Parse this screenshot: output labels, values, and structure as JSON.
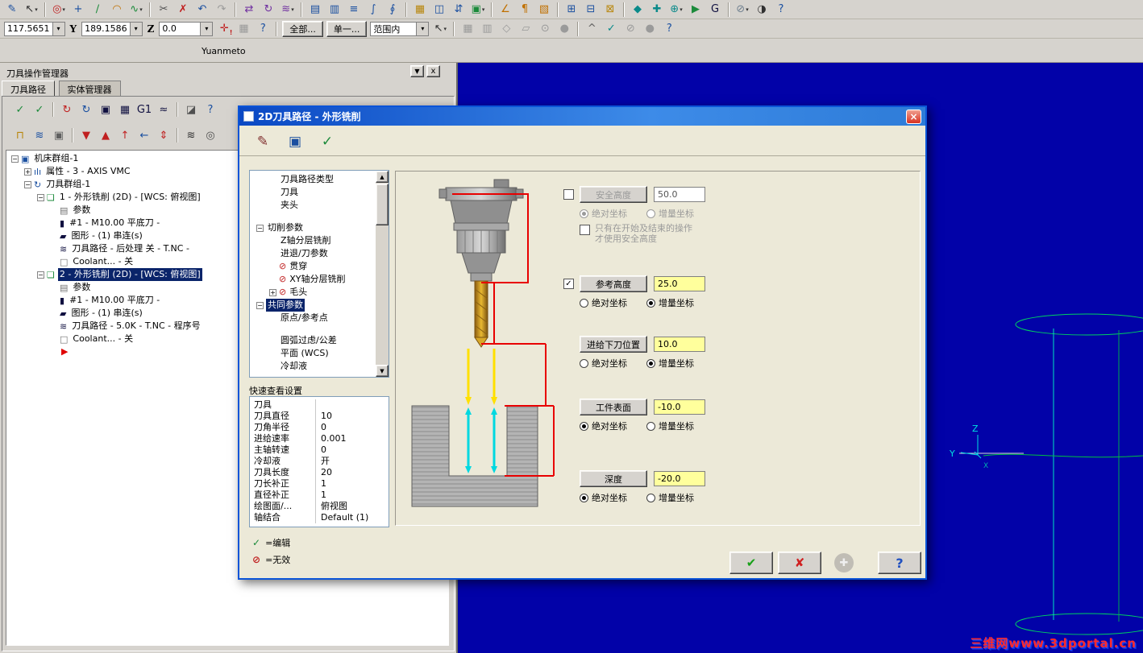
{
  "app": {
    "label": "Yuanmeto"
  },
  "colors": {
    "selection_blue": "#0a246a",
    "value_yellow": "#ffff9c",
    "viewport_blue": "#0202a8",
    "level_line_red": "#e80000",
    "rapid_arrow_yellow": "#ffe000",
    "feed_arrow_cyan": "#00d8e0",
    "ok_green": "#18a018",
    "cancel_red": "#d02020"
  },
  "toolbar_main": {
    "icons": [
      {
        "n": "sketch-icon",
        "g": "✎",
        "c": "#1a4fa0"
      },
      {
        "n": "cursor-select-icon",
        "g": "↖",
        "c": "#303030",
        "dd": true
      },
      {
        "sep": true
      },
      {
        "n": "analyze-icon",
        "g": "◎",
        "c": "#c02020",
        "dd": true
      },
      {
        "n": "point-icon",
        "g": "+",
        "c": "#1a4fa0"
      },
      {
        "n": "line-icon",
        "g": "∕",
        "c": "#1b8a3a"
      },
      {
        "n": "arc-icon",
        "g": "◠",
        "c": "#c07000"
      },
      {
        "n": "spline-icon",
        "g": "∿",
        "c": "#1b8a3a",
        "dd": true
      },
      {
        "sep": true
      },
      {
        "n": "trim-icon",
        "g": "✂",
        "c": "#505050"
      },
      {
        "n": "delete-icon",
        "g": "✗",
        "c": "#c02020"
      },
      {
        "n": "undo-icon",
        "g": "↶",
        "c": "#1a4fa0"
      },
      {
        "n": "redo-icon",
        "g": "↷",
        "c": "#9a9a9a"
      },
      {
        "sep": true
      },
      {
        "n": "xform-mirror-icon",
        "g": "⇄",
        "c": "#7030a0"
      },
      {
        "n": "xform-rotate-icon",
        "g": "↻",
        "c": "#7030a0"
      },
      {
        "n": "xform-offset-icon",
        "g": "≋",
        "c": "#7030a0",
        "dd": true
      },
      {
        "sep": true
      },
      {
        "n": "levels-icon",
        "g": "▤",
        "c": "#1a4fa0"
      },
      {
        "n": "attributes-icon",
        "g": "▥",
        "c": "#1a4fa0"
      },
      {
        "n": "groups-icon",
        "g": "≡",
        "c": "#1a4fa0"
      },
      {
        "n": "mask-icon",
        "g": "∫",
        "c": "#1a4fa0"
      },
      {
        "n": "blank-icon",
        "g": "∮",
        "c": "#1a4fa0"
      },
      {
        "sep": true
      },
      {
        "n": "grid-icon",
        "g": "▦",
        "c": "#b8860b"
      },
      {
        "n": "viewsheet-icon",
        "g": "◫",
        "c": "#1a4fa0"
      },
      {
        "n": "combine-views-icon",
        "g": "⇵",
        "c": "#1a4fa0"
      },
      {
        "n": "shade-icon",
        "g": "▣",
        "c": "#1b8a3a",
        "dd": true
      },
      {
        "sep": true
      },
      {
        "n": "dimension-icon",
        "g": "∠",
        "c": "#c07000"
      },
      {
        "n": "note-icon",
        "g": "¶",
        "c": "#c07000"
      },
      {
        "n": "hatch-icon",
        "g": "▧",
        "c": "#c07000"
      },
      {
        "sep": true
      },
      {
        "n": "machine-def-icon",
        "g": "⊞",
        "c": "#1a4fa0"
      },
      {
        "n": "control-def-icon",
        "g": "⊟",
        "c": "#1a4fa0"
      },
      {
        "n": "material-icon",
        "g": "⊠",
        "c": "#b8860b"
      },
      {
        "sep": true
      },
      {
        "n": "toolpath-contour-icon",
        "g": "◆",
        "c": "#0a8a8a"
      },
      {
        "n": "toolpath-drill-icon",
        "g": "✚",
        "c": "#0a8a8a"
      },
      {
        "n": "toolpath-pocket-icon",
        "g": "⊕",
        "c": "#0a8a8a",
        "dd": true
      },
      {
        "n": "verify-icon",
        "g": "▶",
        "c": "#1b8a3a"
      },
      {
        "n": "post-icon",
        "g": "G",
        "c": "#101040"
      },
      {
        "sep": true
      },
      {
        "n": "utilities-icon",
        "g": "⊘",
        "c": "#708090",
        "dd": true
      },
      {
        "n": "settings-icon",
        "g": "◑",
        "c": "#303030"
      },
      {
        "n": "help-icon",
        "g": "?",
        "c": "#1a4fa0"
      }
    ]
  },
  "toolbar_second": {
    "coord_x": "117.5651",
    "axis_y": "Y",
    "coord_y": "189.1586",
    "axis_z": "Z",
    "coord_z": "0.0",
    "btn_all": "全部...",
    "btn_single": "单一...",
    "combo_range": "范围内",
    "icons_mid": [
      {
        "n": "autocursor-icon",
        "g": "✛",
        "c": "#c02020",
        "badge": "!"
      },
      {
        "n": "fastpoint-icon",
        "g": "▦",
        "c": "#a0a0a0",
        "disabled": true
      },
      {
        "n": "cursor-help-icon",
        "g": "?",
        "c": "#1a4fa0"
      },
      {
        "sep": true
      }
    ],
    "icons_right": [
      {
        "n": "selection-pointer-icon",
        "g": "↖",
        "c": "#303030",
        "dd": true
      },
      {
        "sep": true
      },
      {
        "n": "select-window-icon",
        "g": "▦",
        "c": "#9a9a9a",
        "disabled": true
      },
      {
        "n": "select-group-icon",
        "g": "▥",
        "c": "#9a9a9a",
        "disabled": true
      },
      {
        "n": "select-polygon-icon",
        "g": "◇",
        "c": "#9a9a9a",
        "disabled": true
      },
      {
        "n": "select-vector-icon",
        "g": "▱",
        "c": "#9a9a9a",
        "disabled": true
      },
      {
        "n": "select-area-icon",
        "g": "⊙",
        "c": "#9a9a9a",
        "disabled": true
      },
      {
        "n": "select-solid-icon",
        "g": "●",
        "c": "#9a9a9a",
        "disabled": true
      },
      {
        "sep": true
      },
      {
        "n": "select-last-icon",
        "g": "^",
        "c": "#606060"
      },
      {
        "n": "validate-selection-icon",
        "g": "✓",
        "c": "#0a8a8a"
      },
      {
        "n": "select-invert-icon",
        "g": "⊘",
        "c": "#9a9a9a",
        "disabled": true
      },
      {
        "n": "select-mask-icon",
        "g": "●",
        "c": "#9a9a9a",
        "disabled": true
      },
      {
        "n": "quick-help-icon",
        "g": "?",
        "c": "#1a4fa0"
      }
    ]
  },
  "manager": {
    "title": "刀具操作管理器",
    "tabs": [
      "刀具路径",
      "实体管理器"
    ],
    "toolbar1": [
      {
        "n": "select-all-operations-icon",
        "g": "✓",
        "c": "#1b8a3a"
      },
      {
        "n": "select-dirty-operations-icon",
        "g": "✓",
        "c": "#1b8a3a"
      },
      {
        "sep": true
      },
      {
        "n": "regen-selected-icon",
        "g": "↻",
        "c": "#c02020"
      },
      {
        "n": "regen-all-icon",
        "g": "↻",
        "c": "#1a4fa0"
      },
      {
        "n": "backplot-icon",
        "g": "▣",
        "c": "#101040"
      },
      {
        "n": "verify-operations-icon",
        "g": "▦",
        "c": "#101040"
      },
      {
        "n": "post-g1-icon",
        "g": "G1",
        "c": "#101040"
      },
      {
        "n": "highfeed-icon",
        "g": "≈",
        "c": "#101040"
      },
      {
        "sep": true
      },
      {
        "n": "delete-operations-icon",
        "g": "◪",
        "c": "#505050"
      },
      {
        "n": "operations-help-icon",
        "g": "?",
        "c": "#1a4fa0"
      }
    ],
    "toolbar2": [
      {
        "n": "lock-icon",
        "g": "⊓",
        "c": "#b8860b"
      },
      {
        "n": "toggle-toolpath-display-icon",
        "g": "≋",
        "c": "#1a4fa0"
      },
      {
        "n": "toggle-post-icon",
        "g": "▣",
        "c": "#606060"
      },
      {
        "sep": true
      },
      {
        "n": "move-insert-down-icon",
        "g": "▼",
        "c": "#c02020"
      },
      {
        "n": "move-insert-up-icon",
        "g": "▲",
        "c": "#c02020"
      },
      {
        "n": "move-insert-top-icon",
        "g": "↑",
        "c": "#c02020"
      },
      {
        "n": "scroll-insert-icon",
        "g": "←",
        "c": "#1a4fa0"
      },
      {
        "n": "insert-arrow-icon",
        "g": "⇕",
        "c": "#c02020"
      },
      {
        "sep": true
      },
      {
        "n": "display-only-selected-icon",
        "g": "≋",
        "c": "#303030"
      },
      {
        "n": "toolpath-options-icon",
        "g": "◎",
        "c": "#505050"
      }
    ],
    "tree": [
      {
        "t": "机床群组-1",
        "lv": 0,
        "exp": "minus",
        "icon": "machine-group-icon",
        "g": "▣",
        "c": "#1a4fa0"
      },
      {
        "t": "属性 - 3 - AXIS VMC",
        "lv": 1,
        "exp": "plus",
        "icon": "properties-icon",
        "g": "ılı",
        "c": "#1a4fa0"
      },
      {
        "t": "刀具群组-1",
        "lv": 1,
        "exp": "minus",
        "icon": "tool-group-icon",
        "g": "↻",
        "c": "#1a4fa0"
      },
      {
        "t": "1 - 外形铣削 (2D) - [WCS: 俯视图]",
        "lv": 2,
        "exp": "minus",
        "icon": "operation-folder-icon",
        "g": "❏",
        "c": "#1b8a3a"
      },
      {
        "t": "参数",
        "lv": 3,
        "icon": "parameters-icon",
        "g": "▤",
        "c": "#707070"
      },
      {
        "t": "#1 - M10.00 平底刀 -",
        "lv": 3,
        "icon": "tool-icon",
        "g": "▮",
        "c": "#101040"
      },
      {
        "t": "图形 - (1) 串连(s)",
        "lv": 3,
        "icon": "geometry-icon",
        "g": "▰",
        "c": "#101040"
      },
      {
        "t": "刀具路径 - 后处理 关 - T.NC -",
        "lv": 3,
        "icon": "toolpath-file-icon",
        "g": "≋",
        "c": "#101040"
      },
      {
        "t": "Coolant... - 关",
        "lv": 3,
        "icon": "coolant-icon",
        "g": "□",
        "c": "#707070"
      },
      {
        "t": "2 - 外形铣削 (2D) - [WCS: 俯视图]",
        "lv": 2,
        "exp": "minus",
        "sel": true,
        "icon": "operation-folder-icon",
        "g": "❏",
        "c": "#1b8a3a"
      },
      {
        "t": "参数",
        "lv": 3,
        "icon": "parameters-icon",
        "g": "▤",
        "c": "#707070"
      },
      {
        "t": "#1 - M10.00 平底刀 -",
        "lv": 3,
        "icon": "tool-icon",
        "g": "▮",
        "c": "#101040"
      },
      {
        "t": "图形 - (1) 串连(s)",
        "lv": 3,
        "icon": "geometry-icon",
        "g": "▰",
        "c": "#101040"
      },
      {
        "t": "刀具路径 - 5.0K - T.NC - 程序号",
        "lv": 3,
        "icon": "toolpath-file-icon",
        "g": "≋",
        "c": "#101040"
      },
      {
        "t": "Coolant... - 关",
        "lv": 3,
        "icon": "coolant-icon",
        "g": "□",
        "c": "#707070"
      },
      {
        "t": "",
        "lv": 3,
        "marker": true
      }
    ]
  },
  "dialog": {
    "title": "2D刀具路径 - 外形铣削",
    "close_glyph": "×",
    "toolbar_icons": [
      {
        "n": "tool-icon",
        "g": "✎",
        "c": "#803030"
      },
      {
        "n": "save-parameters-icon",
        "g": "▣",
        "c": "#1a4fa0"
      },
      {
        "n": "verify-parameters-icon",
        "g": "✓",
        "c": "#1b8a3a"
      }
    ],
    "tree_items": [
      {
        "t": "刀具路径类型",
        "lv": 1
      },
      {
        "t": "刀具",
        "lv": 1
      },
      {
        "t": "夹头",
        "lv": 1
      },
      {
        "t": "切削参数",
        "lv": 0,
        "exp": "minus",
        "gap": true
      },
      {
        "t": "Z轴分层铣削",
        "lv": 1
      },
      {
        "t": "进退/刀参数",
        "lv": 1
      },
      {
        "t": "贯穿",
        "lv": 1,
        "mark": "invalid"
      },
      {
        "t": "XY轴分层铣削",
        "lv": 1,
        "mark": "invalid"
      },
      {
        "t": "毛头",
        "lv": 1,
        "exp": "plus",
        "mark": "invalid"
      },
      {
        "t": "共同参数",
        "lv": 0,
        "exp": "minus",
        "sel": true
      },
      {
        "t": "原点/参考点",
        "lv": 1
      },
      {
        "t": "圆弧过虑/公差",
        "lv": 1,
        "gap": true
      },
      {
        "t": "平面 (WCS)",
        "lv": 1
      },
      {
        "t": "冷却液",
        "lv": 1
      }
    ],
    "quick_title": "快速查看设置",
    "quick_rows": [
      {
        "k": "刀具",
        "v": ""
      },
      {
        "k": "刀具直径",
        "v": "10"
      },
      {
        "k": "刀角半径",
        "v": "0"
      },
      {
        "k": "进给速率",
        "v": "0.001"
      },
      {
        "k": "主轴转速",
        "v": "0"
      },
      {
        "k": "冷却液",
        "v": "开"
      },
      {
        "k": "刀具长度",
        "v": "20"
      },
      {
        "k": "刀长补正",
        "v": "1"
      },
      {
        "k": "直径补正",
        "v": "1"
      },
      {
        "k": "绘图面/...",
        "v": "俯视图"
      },
      {
        "k": "轴结合",
        "v": "Default (1)"
      }
    ],
    "legend": [
      {
        "mark": "✓",
        "color": "#1b8a3a",
        "text": "=编辑"
      },
      {
        "mark": "⊘",
        "color": "#c02020",
        "text": "=无效"
      }
    ],
    "params": {
      "abs_label": "绝对坐标",
      "inc_label": "增量坐标",
      "rows": [
        {
          "key": "safety",
          "label": "安全高度",
          "value": "50.0",
          "checkbox": "unchecked",
          "disabled": true,
          "value_bg": "#ffffff",
          "abs": true,
          "note": [
            "只有在开始及结束的操作",
            "才使用安全高度"
          ]
        },
        {
          "key": "reference",
          "label": "参考高度",
          "value": "25.0",
          "checkbox": "checked",
          "value_bg": "#ffff9c",
          "inc": true
        },
        {
          "key": "feed",
          "label": "进给下刀位置",
          "value": "10.0",
          "value_bg": "#ffff9c",
          "inc": true
        },
        {
          "key": "surface",
          "label": "工件表面",
          "value": "-10.0",
          "value_bg": "#ffff9c",
          "abs": true
        },
        {
          "key": "depth",
          "label": "深度",
          "value": "-20.0",
          "value_bg": "#ffff9c",
          "abs": true
        }
      ]
    },
    "buttons": {
      "ok_glyph": "✔",
      "cancel_glyph": "✘",
      "apply_glyph": "✚",
      "help_glyph": "?"
    }
  },
  "viewport": {
    "axis_z": "Z",
    "axis_y": "Y",
    "axis_x": "X",
    "watermark": "三维网www.3dportal.cn"
  }
}
